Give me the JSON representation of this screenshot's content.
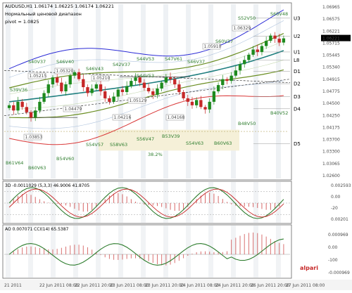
{
  "header": {
    "line1": "AUDUSD,H1  1.06174 1.06225 1.06174 1.06221",
    "line2": "Нормальный ценовой диапазон",
    "line3": "pivot = 1.0825"
  },
  "levels": [
    {
      "name": "U3",
      "price": 1.068
    },
    {
      "name": "U2",
      "price": 1.0628
    },
    {
      "name": "U1",
      "price": 1.0583
    },
    {
      "name": "L8",
      "price": 1.056
    },
    {
      "name": "D1",
      "price": 1.0527
    },
    {
      "name": "D2",
      "price": 1.0492
    },
    {
      "name": "D3",
      "price": 1.0455
    },
    {
      "name": "D4",
      "price": 1.042
    },
    {
      "name": "D5",
      "price": 1.032
    }
  ],
  "price_axis_ticks": [
    "1.06965",
    "1.06575",
    "1.06221",
    "1.05715",
    "1.05445",
    "1.05340",
    "1.04915",
    "1.04775",
    "1.04500",
    "1.04250",
    "1.04175",
    "1.03700",
    "1.03300",
    "1.03065",
    "1.02600"
  ],
  "price_annotations": [
    "1.06329",
    "1.05910",
    "1.05215",
    "1.05320",
    "1.05129",
    "1.05210",
    "1.04479",
    "1.04216",
    "1.04168",
    "1.03853"
  ],
  "ma_labels": [
    "S52V50",
    "S60V48",
    "S60V37",
    "S40V37",
    "S46V40",
    "S46V43",
    "S42V37",
    "S44V53",
    "S47V61",
    "S46V37",
    "S39V36",
    "S44V53",
    "S54V57",
    "S58V63",
    "S56V47",
    "B53V39",
    "S54V63",
    "B60V63",
    "B48V50",
    "B40V52",
    "B61V64",
    "B60V63",
    "B54V60"
  ],
  "fib_label": "38.2%",
  "indicator1": {
    "label": "3D  -0.0011029  (5,3,3)  46.9006  41.8705",
    "axis_ticks": [
      "0.002593",
      "0.00",
      "-20",
      "0.00201"
    ],
    "band_labels": [
      "80",
      "50",
      "20"
    ]
  },
  "indicator2": {
    "label": "AO  0.007071  CCI(14)  65.5387",
    "axis_ticks": [
      "0.000969",
      "0.00",
      "-100",
      "-0.000969"
    ]
  },
  "time_axis": [
    "21 2011",
    "22 Jun 2011 08:00",
    "22 Jun 2011 20:00",
    "23 Jun 2011 08:00",
    "23 Jun 2011 20:00",
    "24 Jun 2011 08:00",
    "24 Jun 2011 20:00",
    "26 Jun 2011 20:00",
    "27 Jun 2011 08:00"
  ],
  "watermark": "alpari",
  "chart_data": {
    "type": "candlestick",
    "symbol": "AUDUSD",
    "timeframe": "H1",
    "ylim": [
      1.022,
      1.072
    ],
    "close": [
      1.043,
      1.0415,
      1.044,
      1.0425,
      1.041,
      1.0395,
      1.0415,
      1.044,
      1.0465,
      1.049,
      1.051,
      1.0495,
      1.047,
      1.049,
      1.0515,
      1.0525,
      1.0505,
      1.0482,
      1.0465,
      1.0478,
      1.049,
      1.047,
      1.045,
      1.044,
      1.0455,
      1.0475,
      1.0468,
      1.0485,
      1.05,
      1.051,
      1.0495,
      1.048,
      1.047,
      1.046,
      1.0478,
      1.0495,
      1.051,
      1.0505,
      1.049,
      1.0468,
      1.045,
      1.044,
      1.043,
      1.0445,
      1.0425,
      1.0418,
      1.044,
      1.047,
      1.0488,
      1.0505,
      1.05,
      1.0515,
      1.053,
      1.0548,
      1.056,
      1.0575,
      1.059,
      1.0583,
      1.06,
      1.0615,
      1.063,
      1.0621,
      1.061,
      1.0622
    ]
  }
}
